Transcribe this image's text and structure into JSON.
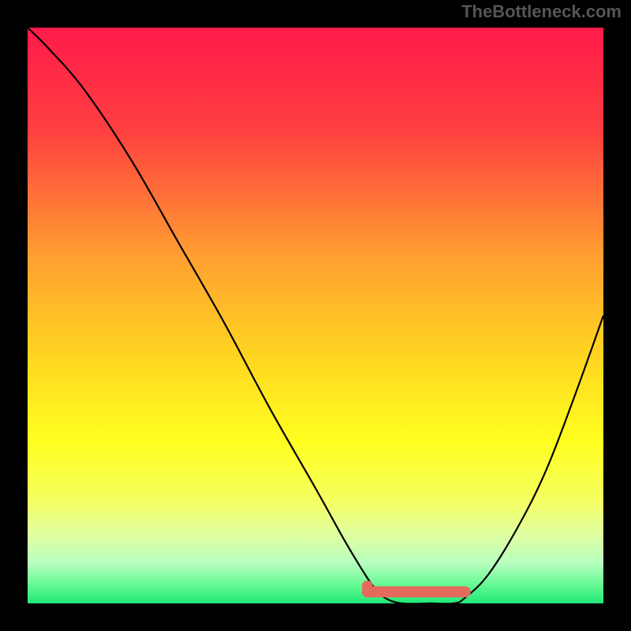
{
  "watermark": "TheBottleneck.com",
  "chart_data": {
    "type": "line",
    "title": "",
    "xlabel": "",
    "ylabel": "",
    "xlim": [
      0,
      100
    ],
    "ylim": [
      0,
      100
    ],
    "curve": [
      {
        "x": 0,
        "y": 100
      },
      {
        "x": 4,
        "y": 96
      },
      {
        "x": 10,
        "y": 89
      },
      {
        "x": 18,
        "y": 77
      },
      {
        "x": 26,
        "y": 63
      },
      {
        "x": 34,
        "y": 49
      },
      {
        "x": 42,
        "y": 34
      },
      {
        "x": 50,
        "y": 20
      },
      {
        "x": 55,
        "y": 11
      },
      {
        "x": 58,
        "y": 6
      },
      {
        "x": 60,
        "y": 3
      },
      {
        "x": 62,
        "y": 1
      },
      {
        "x": 65,
        "y": 0
      },
      {
        "x": 70,
        "y": 0
      },
      {
        "x": 74,
        "y": 0
      },
      {
        "x": 76,
        "y": 1
      },
      {
        "x": 80,
        "y": 5
      },
      {
        "x": 85,
        "y": 13
      },
      {
        "x": 90,
        "y": 23
      },
      {
        "x": 95,
        "y": 36
      },
      {
        "x": 100,
        "y": 50
      }
    ],
    "marker_band": {
      "x_start": 59,
      "x_end": 76,
      "y": 2
    },
    "dot": {
      "x": 59,
      "y": 3
    },
    "gradient_stops": [
      {
        "offset": 0,
        "color": "#ff1a4a"
      },
      {
        "offset": 18,
        "color": "#ff4040"
      },
      {
        "offset": 40,
        "color": "#ffa030"
      },
      {
        "offset": 58,
        "color": "#ffd820"
      },
      {
        "offset": 72,
        "color": "#ffff20"
      },
      {
        "offset": 82,
        "color": "#f5ff60"
      },
      {
        "offset": 88,
        "color": "#e0ffa0"
      },
      {
        "offset": 93,
        "color": "#b8ffc0"
      },
      {
        "offset": 97,
        "color": "#60f890"
      },
      {
        "offset": 100,
        "color": "#20e878"
      }
    ]
  }
}
